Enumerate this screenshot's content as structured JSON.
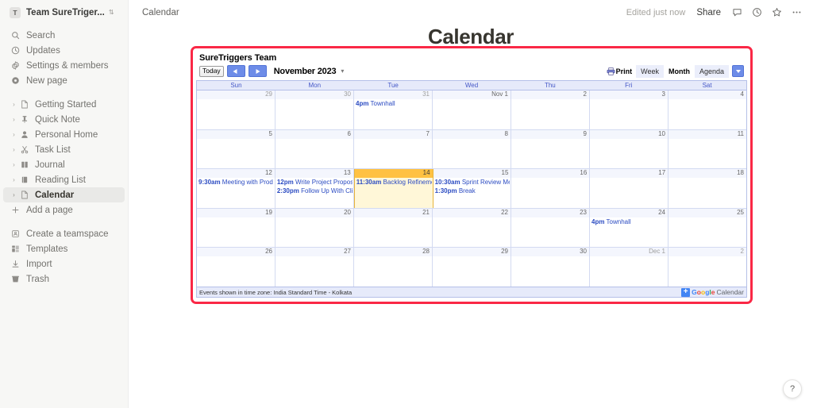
{
  "sidebar": {
    "workspace": {
      "initial": "T",
      "name": "Team SureTriger...",
      "switch_icon": "switcher-icon"
    },
    "actions": [
      {
        "icon": "search-icon",
        "label": "Search"
      },
      {
        "icon": "clock-icon",
        "label": "Updates"
      },
      {
        "icon": "gear-icon",
        "label": "Settings & members"
      },
      {
        "icon": "new-page-icon",
        "label": "New page"
      }
    ],
    "pages": [
      {
        "icon": "document-icon",
        "label": "Getting Started",
        "selected": false
      },
      {
        "icon": "pin-icon",
        "label": "Quick Note",
        "selected": false
      },
      {
        "icon": "person-icon",
        "label": "Personal Home",
        "selected": false
      },
      {
        "icon": "scissors-icon",
        "label": "Task List",
        "selected": false
      },
      {
        "icon": "book-icon",
        "label": "Journal",
        "selected": false
      },
      {
        "icon": "notebook-icon",
        "label": "Reading List",
        "selected": false
      },
      {
        "icon": "document-icon",
        "label": "Calendar",
        "selected": true
      }
    ],
    "add_page": {
      "icon": "plus-icon",
      "label": "Add a page"
    },
    "footer": [
      {
        "icon": "teamspace-icon",
        "label": "Create a teamspace"
      },
      {
        "icon": "templates-icon",
        "label": "Templates"
      },
      {
        "icon": "import-icon",
        "label": "Import"
      },
      {
        "icon": "trash-icon",
        "label": "Trash"
      }
    ]
  },
  "topbar": {
    "breadcrumb": "Calendar",
    "edited": "Edited just now",
    "share_label": "Share",
    "icons": [
      {
        "name": "comment-icon"
      },
      {
        "name": "clock-history-icon"
      },
      {
        "name": "star-icon"
      },
      {
        "name": "more-options-icon"
      }
    ]
  },
  "page": {
    "title": "Calendar"
  },
  "calendar": {
    "border_color": "#fa2846",
    "title": "SureTriggers Team",
    "toolbar": {
      "today_label": "Today",
      "prev_icon": "chevron-left-icon",
      "next_icon": "chevron-right-icon",
      "month_label": "November 2023",
      "month_dropdown_icon": "chevron-down-icon",
      "print_label": "Print",
      "print_icon": "printer-icon",
      "views": [
        {
          "label": "Week",
          "active": false
        },
        {
          "label": "Month",
          "active": true
        },
        {
          "label": "Agenda",
          "active": false
        }
      ],
      "view_dropdown_icon": "chevron-down-icon"
    },
    "day_names": [
      "Sun",
      "Mon",
      "Tue",
      "Wed",
      "Thu",
      "Fri",
      "Sat"
    ],
    "weeks": [
      [
        {
          "num": "29",
          "muted": true,
          "today": false,
          "events": []
        },
        {
          "num": "30",
          "muted": true,
          "today": false,
          "events": []
        },
        {
          "num": "31",
          "muted": true,
          "today": false,
          "events": [
            {
              "time": "4pm",
              "title": "Townhall"
            }
          ]
        },
        {
          "num": "Nov 1",
          "muted": false,
          "today": false,
          "events": []
        },
        {
          "num": "2",
          "muted": false,
          "today": false,
          "events": []
        },
        {
          "num": "3",
          "muted": false,
          "today": false,
          "events": []
        },
        {
          "num": "4",
          "muted": false,
          "today": false,
          "events": []
        }
      ],
      [
        {
          "num": "5",
          "muted": false,
          "today": false,
          "events": []
        },
        {
          "num": "6",
          "muted": false,
          "today": false,
          "events": []
        },
        {
          "num": "7",
          "muted": false,
          "today": false,
          "events": []
        },
        {
          "num": "8",
          "muted": false,
          "today": false,
          "events": []
        },
        {
          "num": "9",
          "muted": false,
          "today": false,
          "events": []
        },
        {
          "num": "10",
          "muted": false,
          "today": false,
          "events": []
        },
        {
          "num": "11",
          "muted": false,
          "today": false,
          "events": []
        }
      ],
      [
        {
          "num": "12",
          "muted": false,
          "today": false,
          "events": [
            {
              "time": "9:30am",
              "title": "Meeting with Prod"
            }
          ]
        },
        {
          "num": "13",
          "muted": false,
          "today": false,
          "events": [
            {
              "time": "12pm",
              "title": "Write Project Propos"
            },
            {
              "time": "2:30pm",
              "title": "Follow Up With Cli"
            }
          ]
        },
        {
          "num": "14",
          "muted": false,
          "today": true,
          "events": [
            {
              "time": "11:30am",
              "title": "Backlog Refineme"
            }
          ]
        },
        {
          "num": "15",
          "muted": false,
          "today": false,
          "events": [
            {
              "time": "10:30am",
              "title": "Sprint Review Me"
            },
            {
              "time": "1:30pm",
              "title": "Break"
            }
          ]
        },
        {
          "num": "16",
          "muted": false,
          "today": false,
          "events": []
        },
        {
          "num": "17",
          "muted": false,
          "today": false,
          "events": []
        },
        {
          "num": "18",
          "muted": false,
          "today": false,
          "events": []
        }
      ],
      [
        {
          "num": "19",
          "muted": false,
          "today": false,
          "events": []
        },
        {
          "num": "20",
          "muted": false,
          "today": false,
          "events": []
        },
        {
          "num": "21",
          "muted": false,
          "today": false,
          "events": []
        },
        {
          "num": "22",
          "muted": false,
          "today": false,
          "events": []
        },
        {
          "num": "23",
          "muted": false,
          "today": false,
          "events": []
        },
        {
          "num": "24",
          "muted": false,
          "today": false,
          "events": [
            {
              "time": "4pm",
              "title": "Townhall"
            }
          ]
        },
        {
          "num": "25",
          "muted": false,
          "today": false,
          "events": []
        }
      ],
      [
        {
          "num": "26",
          "muted": false,
          "today": false,
          "events": []
        },
        {
          "num": "27",
          "muted": false,
          "today": false,
          "events": []
        },
        {
          "num": "28",
          "muted": false,
          "today": false,
          "events": []
        },
        {
          "num": "29",
          "muted": false,
          "today": false,
          "events": []
        },
        {
          "num": "30",
          "muted": false,
          "today": false,
          "events": []
        },
        {
          "num": "Dec 1",
          "muted": true,
          "today": false,
          "events": []
        },
        {
          "num": "2",
          "muted": true,
          "today": false,
          "events": []
        }
      ]
    ],
    "footer": {
      "timezone_note": "Events shown in time zone: India Standard Time - Kolkata",
      "brand": {
        "plus": "+",
        "g": "G",
        "o1": "o",
        "o2": "o",
        "g2": "g",
        "l": "l",
        "e": "e",
        "suffix": "Calendar"
      }
    }
  },
  "help": {
    "label": "?"
  }
}
